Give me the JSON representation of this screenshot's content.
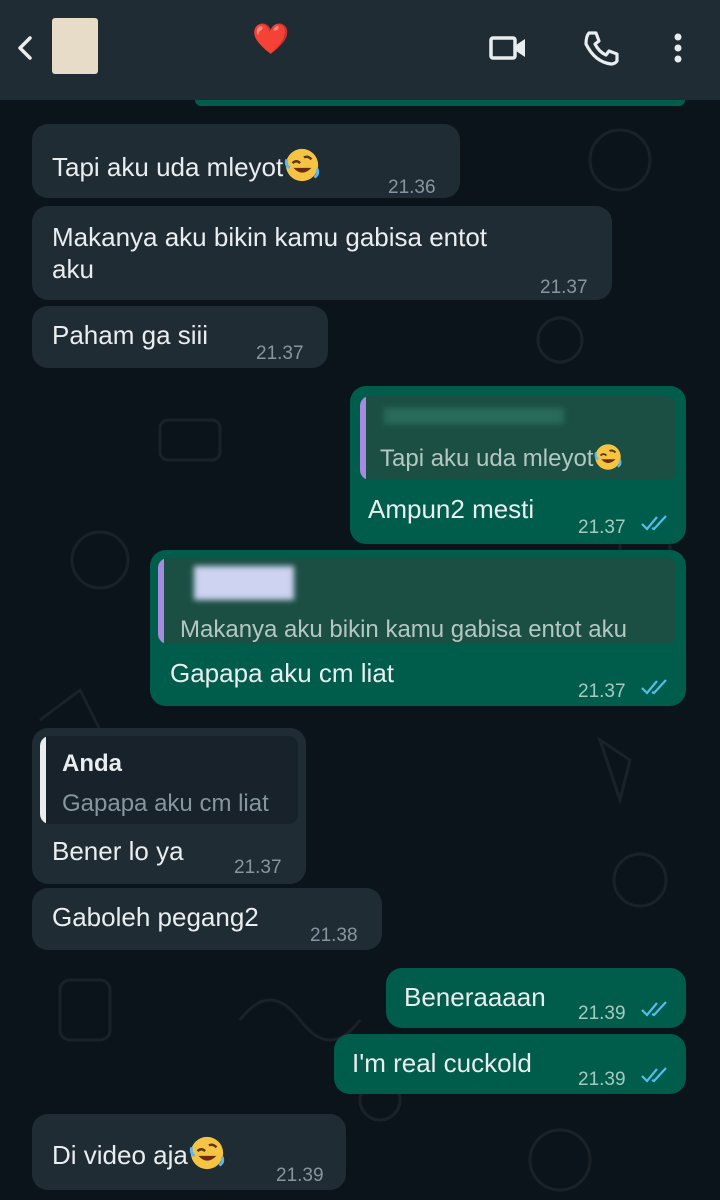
{
  "header": {
    "contact_name": "❤️",
    "icons": [
      "back-arrow-icon",
      "video-call-icon",
      "phone-icon",
      "more-vertical-icon"
    ]
  },
  "colors": {
    "background": "#0b141a",
    "incoming": "#202c33",
    "outgoing": "#005c4b",
    "read_tick": "#53bdeb",
    "quote_bar_out": "#a58be0"
  },
  "messages": [
    {
      "dir": "in",
      "text": "Tapi aku uda mleyot",
      "emoji": "rofl-emoji",
      "time": "21.36"
    },
    {
      "dir": "in",
      "text_line1": "Makanya aku bikin kamu gabisa entot",
      "text_line2": "aku",
      "time": "21.37"
    },
    {
      "dir": "in",
      "text": "Paham ga siii",
      "time": "21.37"
    },
    {
      "dir": "out",
      "quote_text": "Tapi aku uda mleyot",
      "quote_emoji": "rofl-emoji",
      "text": "Ampun2 mesti",
      "time": "21.37",
      "status": "read"
    },
    {
      "dir": "out",
      "quote_text": "Makanya aku bikin kamu gabisa entot aku",
      "text": "Gapapa aku cm liat",
      "time": "21.37",
      "status": "read"
    },
    {
      "dir": "in",
      "quote_author": "Anda",
      "quote_text": "Gapapa aku cm liat",
      "text": "Bener lo ya",
      "time": "21.37"
    },
    {
      "dir": "in",
      "text": "Gaboleh pegang2",
      "time": "21.38"
    },
    {
      "dir": "out",
      "text": "Beneraaaan",
      "time": "21.39",
      "status": "read"
    },
    {
      "dir": "out",
      "text": "I'm real cuckold",
      "time": "21.39",
      "status": "read"
    },
    {
      "dir": "in",
      "text": "Di video aja",
      "emoji": "rofl-emoji",
      "time": "21.39"
    }
  ]
}
